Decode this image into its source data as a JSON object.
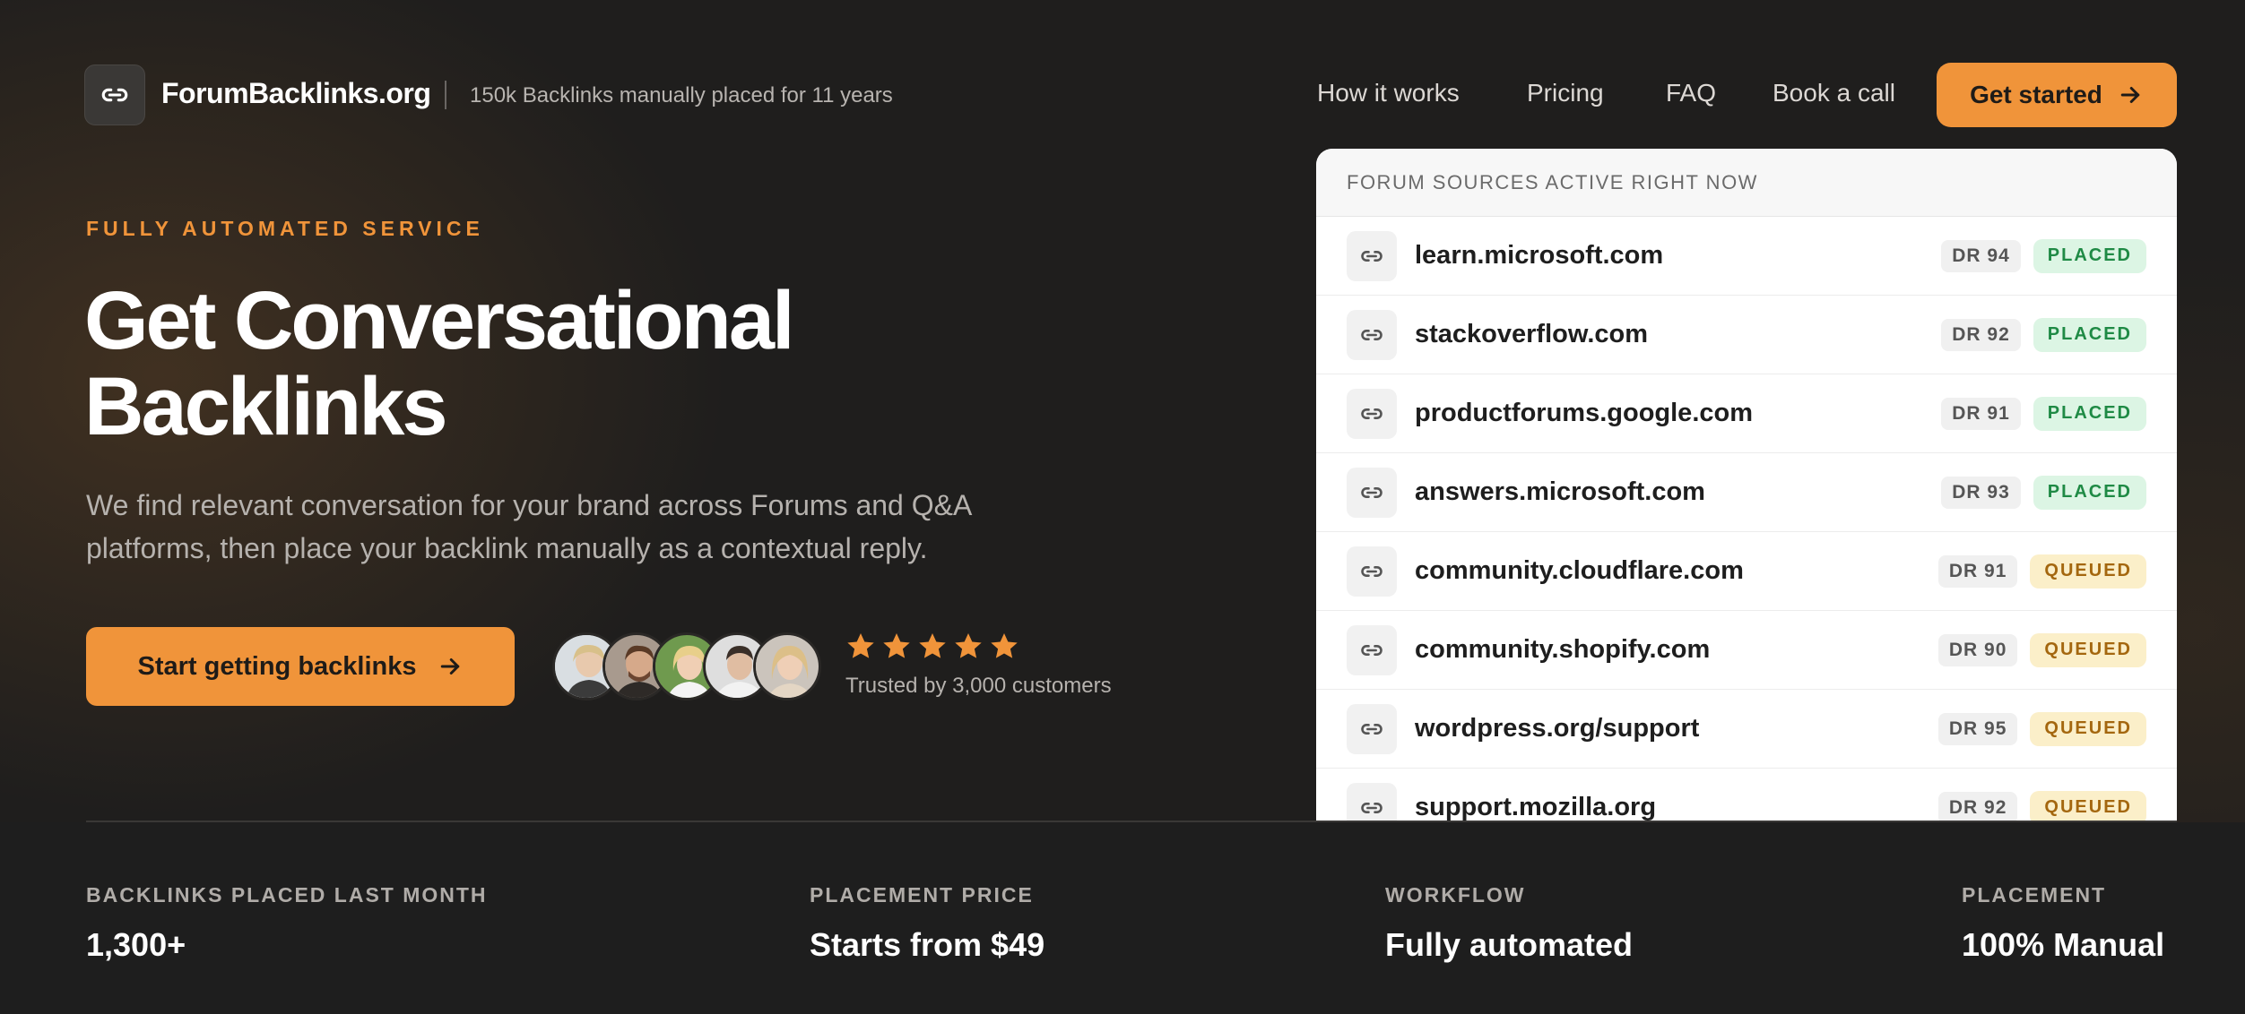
{
  "header": {
    "brand_name": "ForumBacklinks.org",
    "tagline": "150k Backlinks manually placed for 11 years",
    "nav": [
      {
        "label": "How it works"
      },
      {
        "label": "Pricing"
      },
      {
        "label": "FAQ"
      },
      {
        "label": "Book a call"
      }
    ],
    "cta_label": "Get started"
  },
  "hero": {
    "eyebrow": "FULLY AUTOMATED SERVICE",
    "title_line1": "Get Conversational",
    "title_line2": "Backlinks",
    "description": "We find relevant conversation for your brand across Forums and Q&A platforms, then place your backlink manually as a contextual reply.",
    "cta_label": "Start getting backlinks",
    "rating_stars": 5,
    "trusted_text": "Trusted by 3,000 customers"
  },
  "sources_panel": {
    "heading": "FORUM SOURCES ACTIVE RIGHT NOW",
    "rows": [
      {
        "domain": "learn.microsoft.com",
        "dr": "DR 94",
        "status": "PLACED"
      },
      {
        "domain": "stackoverflow.com",
        "dr": "DR 92",
        "status": "PLACED"
      },
      {
        "domain": "productforums.google.com",
        "dr": "DR 91",
        "status": "PLACED"
      },
      {
        "domain": "answers.microsoft.com",
        "dr": "DR 93",
        "status": "PLACED"
      },
      {
        "domain": "community.cloudflare.com",
        "dr": "DR 91",
        "status": "QUEUED"
      },
      {
        "domain": "community.shopify.com",
        "dr": "DR 90",
        "status": "QUEUED"
      },
      {
        "domain": "wordpress.org/support",
        "dr": "DR 95",
        "status": "QUEUED"
      },
      {
        "domain": "support.mozilla.org",
        "dr": "DR 92",
        "status": "QUEUED"
      }
    ]
  },
  "stats": [
    {
      "label": "BACKLINKS PLACED LAST MONTH",
      "value": "1,300+"
    },
    {
      "label": "PLACEMENT PRICE",
      "value": "Starts from $49"
    },
    {
      "label": "WORKFLOW",
      "value": "Fully automated"
    },
    {
      "label": "PLACEMENT",
      "value": "100% Manual"
    }
  ],
  "colors": {
    "accent": "#f0943a",
    "background": "#1f1e1d",
    "placed_bg": "#dcf5e4",
    "placed_text": "#1f8a45",
    "queued_bg": "#fbefc9",
    "queued_text": "#a4670f"
  },
  "icons": {
    "logo": "link-icon",
    "row": "link-icon",
    "cta": "arrow-right-icon",
    "rating": "star-icon"
  }
}
